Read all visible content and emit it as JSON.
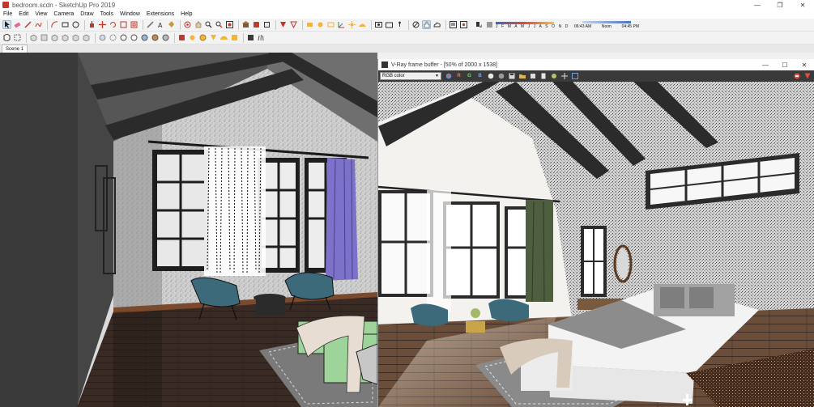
{
  "window": {
    "title": "bedroom.scdn - SketchUp Pro 2019",
    "controls": [
      "—",
      "❐",
      "✕"
    ]
  },
  "menu": [
    "File",
    "Edit",
    "View",
    "Camera",
    "Draw",
    "Tools",
    "Window",
    "Extensions",
    "Help"
  ],
  "shadow": {
    "months": "J F M A M J J A S O N D",
    "time_start": "06:43 AM",
    "time_mid": "Noon",
    "time_end": "04:45 PM"
  },
  "scenes": [
    "Scene 1"
  ],
  "vfb": {
    "title": "V-Ray frame buffer - [50% of 2000 x 1538]",
    "channel": "RGB color",
    "channel_buttons": [
      "R",
      "G",
      "B"
    ],
    "controls": [
      "—",
      "☐",
      "✕"
    ]
  },
  "colors": {
    "accent_blue": "#4b72c2",
    "chair_teal": "#3d6a7a",
    "curtain_purple": "#7d72c9",
    "bench_green": "#9ed39a",
    "floor_dark": "#3a2a24"
  },
  "icons": {
    "toolbar1": [
      "select-arrow-icon",
      "eraser-icon",
      "line-pencil-icon",
      "freehand-icon",
      "arc-icon",
      "rectangle-icon",
      "shapes-icon",
      "push-pull-icon",
      "move-icon",
      "rotate-icon",
      "scale-icon",
      "offset-icon",
      "tape-measure-icon",
      "text-icon",
      "paint-bucket-icon",
      "orbit-icon",
      "pan-icon",
      "zoom-icon",
      "zoom-extents-icon"
    ],
    "toolbar2": [
      "component-icon",
      "group-icon",
      "section-plane-icon",
      "xray-icon",
      "wireframe-icon",
      "hidden-line-icon",
      "shaded-icon",
      "textured-icon",
      "monochrome-icon",
      "shadow-icon",
      "fog-icon",
      "edge-style-icon"
    ]
  }
}
